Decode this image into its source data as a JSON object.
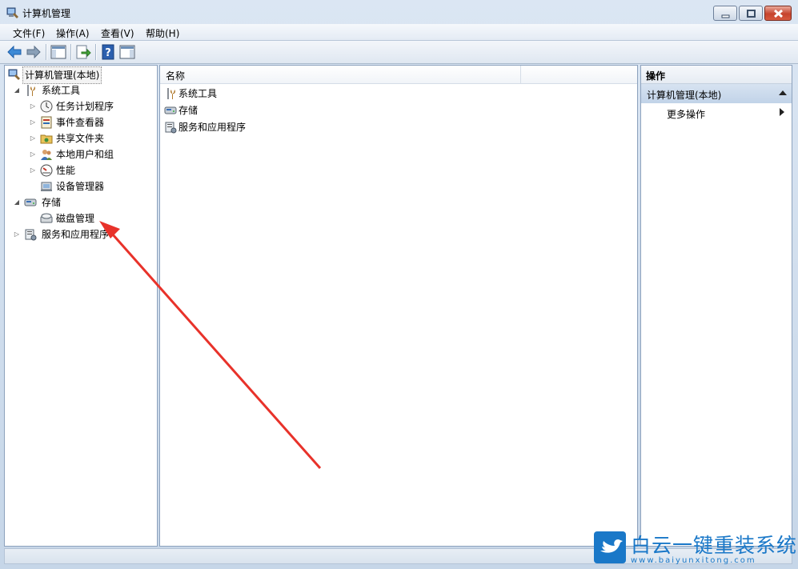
{
  "window": {
    "title": "计算机管理"
  },
  "menu": [
    "文件(F)",
    "操作(A)",
    "查看(V)",
    "帮助(H)"
  ],
  "toolbar": {
    "icons": [
      "back-icon",
      "forward-icon",
      "show-hide-tree-icon",
      "export-list-icon",
      "help-icon",
      "show-hide-action-pane-icon"
    ]
  },
  "tree": {
    "root": "计算机管理(本地)",
    "system_tools": "系统工具",
    "task_scheduler": "任务计划程序",
    "event_viewer": "事件查看器",
    "shared_folders": "共享文件夹",
    "local_users": "本地用户和组",
    "performance": "性能",
    "device_manager": "设备管理器",
    "storage": "存储",
    "disk_management": "磁盘管理",
    "services_apps": "服务和应用程序"
  },
  "list": {
    "column_name": "名称",
    "rows": [
      "系统工具",
      "存储",
      "服务和应用程序"
    ]
  },
  "actions": {
    "title": "操作",
    "section": "计算机管理(本地)",
    "more": "更多操作"
  },
  "watermark": {
    "text": "白云一键重装系统",
    "url": "www.baiyunxitong.com"
  },
  "colors": {
    "accent": "#1a78c8",
    "arrow": "#e8322a"
  }
}
